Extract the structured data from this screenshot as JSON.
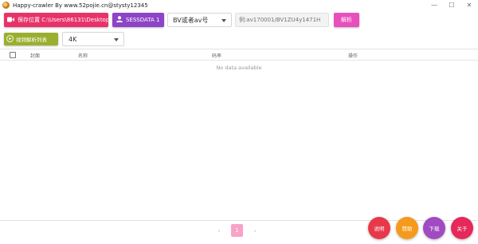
{
  "window": {
    "title": "Happy-crawler By www.52pojie.cn@stysty12345",
    "controls": [
      "—",
      "☐",
      "✕"
    ]
  },
  "toolbar": {
    "save_location_label": "保存位置 C:\\Users\\86131\\Desktop",
    "sessdata_label": "SESSDATA 1",
    "id_type_selected": "BV或者av号",
    "url_placeholder": "例:av170001/BV1ZU4y1471H",
    "parse_label": "解析"
  },
  "toolbar2": {
    "video_list_label": "视频解析列表",
    "quality_selected": "4K"
  },
  "table": {
    "columns": [
      "封面",
      "名称",
      "码率",
      "操作"
    ],
    "empty_text": "No data available",
    "rows": []
  },
  "pagination": {
    "current_page": "1",
    "prev": "‹",
    "next": "›"
  },
  "actions": {
    "help": "说明",
    "reward": "赞助",
    "download": "下载",
    "about": "关于"
  },
  "colors": {
    "save_button": "#e8336a",
    "sessdata_button": "#8e44c6",
    "parse_button": "#e84fbd",
    "video_list_button": "#9aaf2f",
    "page_active": "#f9a2c8"
  }
}
